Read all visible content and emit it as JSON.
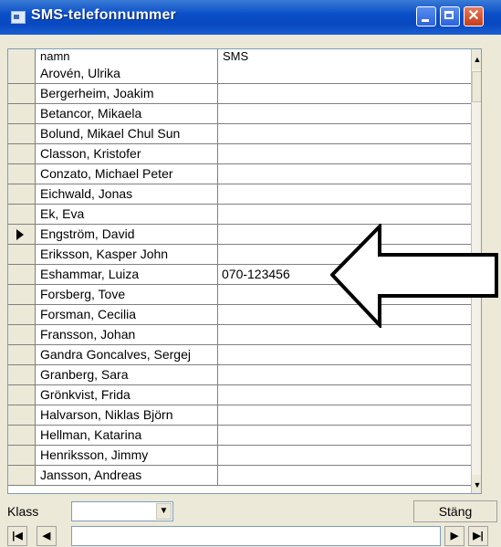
{
  "window": {
    "title": "SMS-telefonnummer",
    "close_glyph": "✕"
  },
  "grid": {
    "headers": {
      "name": "namn",
      "sms": "SMS"
    },
    "rows": [
      {
        "name": "Arovén, Ulrika",
        "sms": ""
      },
      {
        "name": "Bergerheim, Joakim",
        "sms": ""
      },
      {
        "name": "Betancor, Mikaela",
        "sms": ""
      },
      {
        "name": "Bolund, Mikael Chul Sun",
        "sms": ""
      },
      {
        "name": "Classon, Kristofer",
        "sms": ""
      },
      {
        "name": "Conzato, Michael Peter",
        "sms": ""
      },
      {
        "name": "Eichwald, Jonas",
        "sms": ""
      },
      {
        "name": "Ek, Eva",
        "sms": ""
      },
      {
        "name": "Engström, David",
        "sms": "",
        "current": true
      },
      {
        "name": "Eriksson, Kasper John",
        "sms": ""
      },
      {
        "name": "Eshammar, Luiza",
        "sms": "070-123456"
      },
      {
        "name": "Forsberg, Tove",
        "sms": ""
      },
      {
        "name": "Forsman, Cecilia",
        "sms": ""
      },
      {
        "name": "Fransson, Johan",
        "sms": ""
      },
      {
        "name": "Gandra Goncalves, Sergej",
        "sms": ""
      },
      {
        "name": "Granberg, Sara",
        "sms": ""
      },
      {
        "name": "Grönkvist, Frida",
        "sms": ""
      },
      {
        "name": "Halvarson, Niklas Björn",
        "sms": ""
      },
      {
        "name": "Hellman, Katarina",
        "sms": ""
      },
      {
        "name": "Henriksson, Jimmy",
        "sms": ""
      },
      {
        "name": "Jansson, Andreas",
        "sms": ""
      }
    ]
  },
  "footer": {
    "klass_label": "Klass",
    "klass_value": "",
    "close_button_label": "Stäng",
    "nav": {
      "first": "|◀",
      "prev": "◀",
      "next": "▶",
      "last": "▶|"
    }
  },
  "icons": {
    "row_pointer": "row-pointer-icon",
    "annotation_arrow": "arrow-left-icon"
  }
}
